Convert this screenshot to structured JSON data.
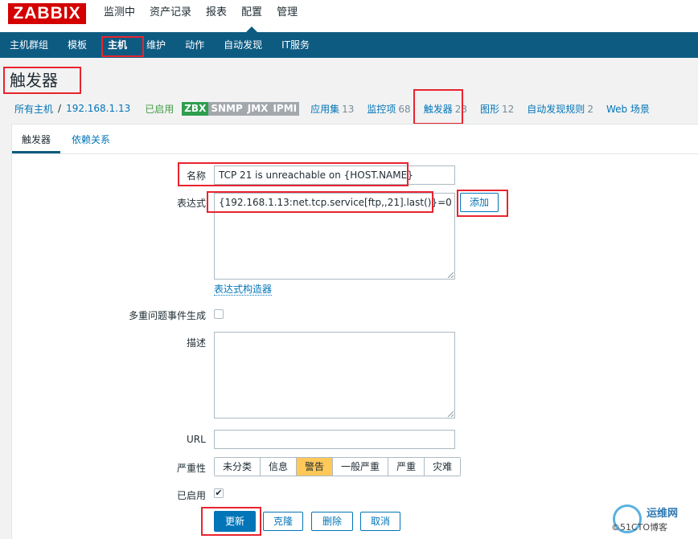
{
  "app": {
    "logo": "ZABBIX"
  },
  "top_menu": [
    "监测中",
    "资产记录",
    "报表",
    "配置",
    "管理"
  ],
  "sub_menu": [
    "主机群组",
    "模板",
    "主机",
    "维护",
    "动作",
    "自动发现",
    "IT服务"
  ],
  "page_title": "触发器",
  "host_nav": {
    "all_hosts": "所有主机",
    "separator": "/",
    "host": "192.168.1.13",
    "status": "已启用",
    "badges": [
      "ZBX",
      "SNMP",
      "JMX",
      "IPMI"
    ],
    "items": [
      {
        "label": "应用集",
        "count": "13"
      },
      {
        "label": "监控项",
        "count": "68"
      },
      {
        "label": "触发器",
        "count": "23"
      },
      {
        "label": "图形",
        "count": "12"
      },
      {
        "label": "自动发现规则",
        "count": "2"
      },
      {
        "label": "Web 场景",
        "count": ""
      }
    ]
  },
  "tabs": [
    "触发器",
    "依赖关系"
  ],
  "form": {
    "name_label": "名称",
    "name_value": "TCP 21 is unreachable on {HOST.NAME}",
    "expression_label": "表达式",
    "expression_value": "{192.168.1.13:net.tcp.service[ftp,,21].last()}=0",
    "add_button": "添加",
    "expression_builder": "表达式构造器",
    "multiple_events_label": "多重问题事件生成",
    "description_label": "描述",
    "description_value": "",
    "url_label": "URL",
    "url_value": "",
    "severity_label": "严重性",
    "severities": [
      "未分类",
      "信息",
      "警告",
      "一般严重",
      "严重",
      "灾难"
    ],
    "severity_selected": "警告",
    "enabled_label": "已启用",
    "enabled_mark": "✔"
  },
  "buttons": {
    "update": "更新",
    "clone": "克隆",
    "delete": "删除",
    "cancel": "取消"
  },
  "watermark": {
    "text": "运维网",
    "sub": "©51CTO博客"
  },
  "colors": {
    "brand_red": "#d40000",
    "nav_blue": "#0e5b82",
    "link_blue": "#0275b8",
    "enabled_green": "#429e47",
    "severity_warning": "#ffc859",
    "highlight_box": "#e8242f"
  }
}
